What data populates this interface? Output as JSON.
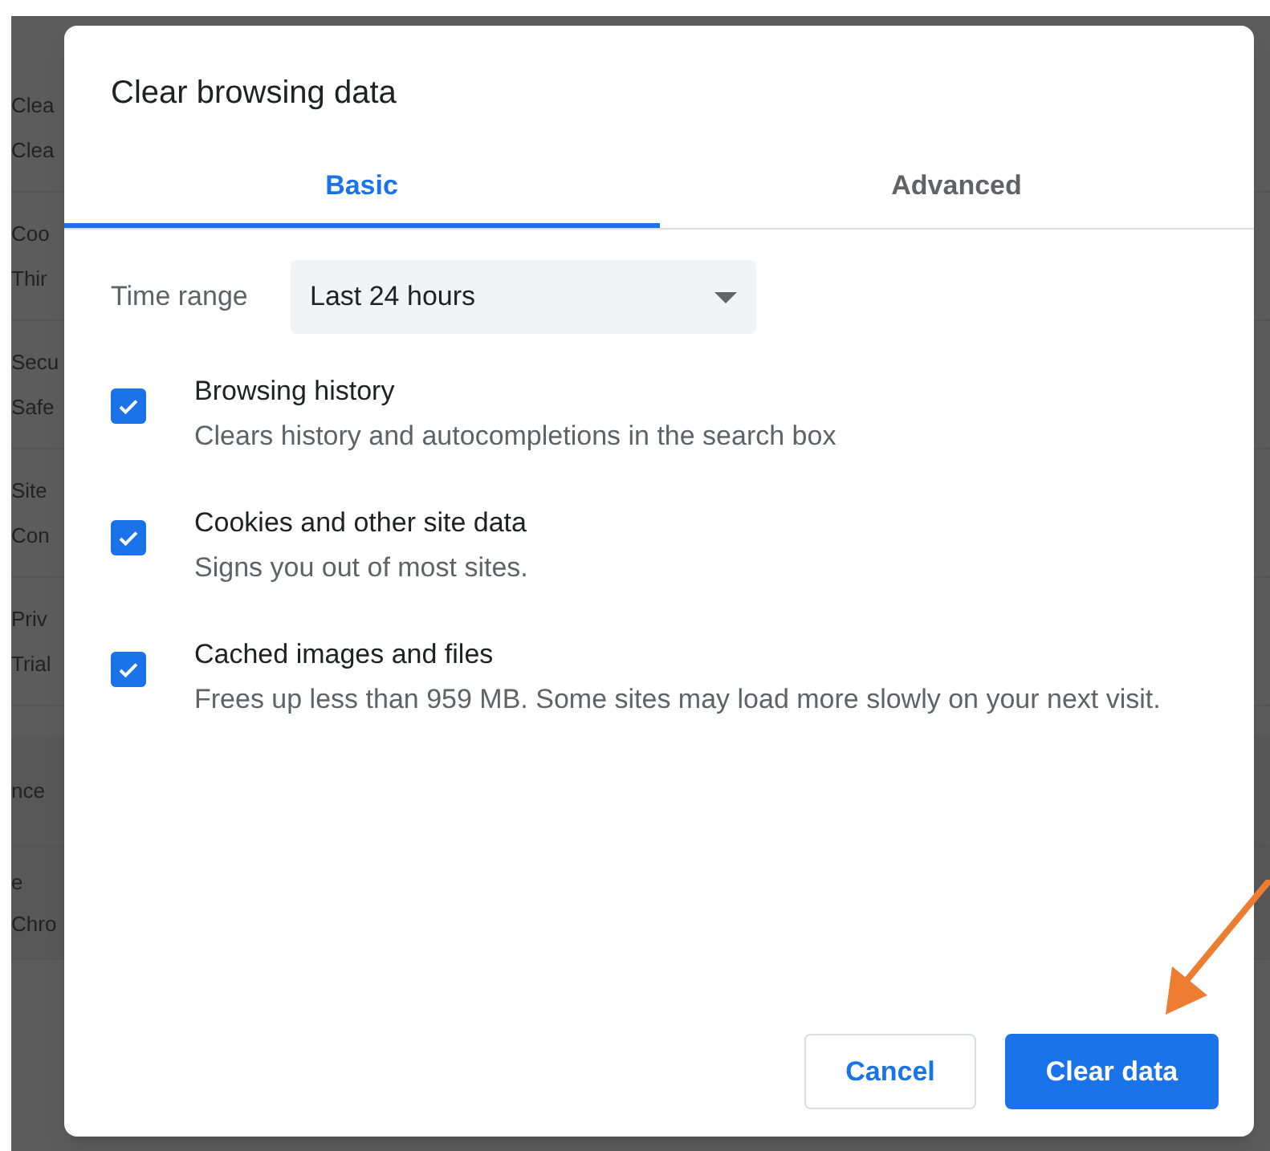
{
  "background_items": [
    {
      "title": "Clea",
      "subtitle": "Clea"
    },
    {
      "title": "Coo",
      "subtitle": "Thir"
    },
    {
      "title": "Secu",
      "subtitle": "Safe"
    },
    {
      "title": "Site",
      "subtitle": "Con"
    },
    {
      "title": "Priv",
      "subtitle": "Trial"
    }
  ],
  "background_section": [
    {
      "title": "nce"
    },
    {
      "title": "e",
      "subtitle": "Chro"
    }
  ],
  "dialog": {
    "title": "Clear browsing data",
    "tabs": [
      {
        "label": "Basic",
        "selected": true
      },
      {
        "label": "Advanced",
        "selected": false
      }
    ],
    "time_range": {
      "label": "Time range",
      "value": "Last 24 hours"
    },
    "options": [
      {
        "title": "Browsing history",
        "description": "Clears history and autocompletions in the search box",
        "checked": true
      },
      {
        "title": "Cookies and other site data",
        "description": "Signs you out of most sites.",
        "checked": true
      },
      {
        "title": "Cached images and files",
        "description": "Frees up less than 959 MB. Some sites may load more slowly on your next visit.",
        "checked": true
      }
    ],
    "buttons": [
      {
        "label": "Cancel",
        "kind": "secondary"
      },
      {
        "label": "Clear data",
        "kind": "primary"
      }
    ]
  },
  "annotation": {
    "arrow": true
  }
}
